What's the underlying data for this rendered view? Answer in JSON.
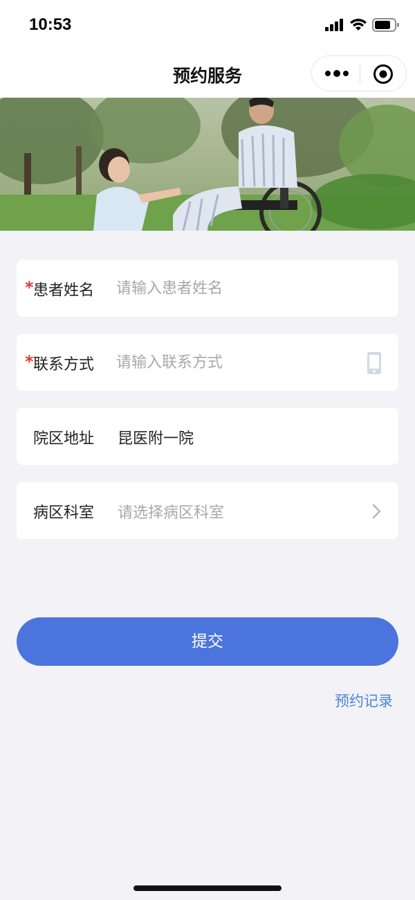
{
  "status_bar": {
    "time": "10:53"
  },
  "nav": {
    "title": "预约服务"
  },
  "form": {
    "patient_name": {
      "required_mark": "*",
      "label": "患者姓名",
      "placeholder": "请输入患者姓名",
      "value": ""
    },
    "contact": {
      "required_mark": "*",
      "label": "联系方式",
      "placeholder": "请输入联系方式",
      "value": "",
      "icon": "phone-icon"
    },
    "campus": {
      "label": "院区地址",
      "value": "昆医附一院"
    },
    "department": {
      "label": "病区科室",
      "placeholder": "请选择病区科室",
      "icon": "chevron-right-icon"
    }
  },
  "actions": {
    "submit_label": "提交",
    "records_label": "预约记录"
  },
  "colors": {
    "accent": "#4b75dc",
    "link": "#4b86d8",
    "required": "#e33b2f",
    "background": "#f3f2f7"
  }
}
